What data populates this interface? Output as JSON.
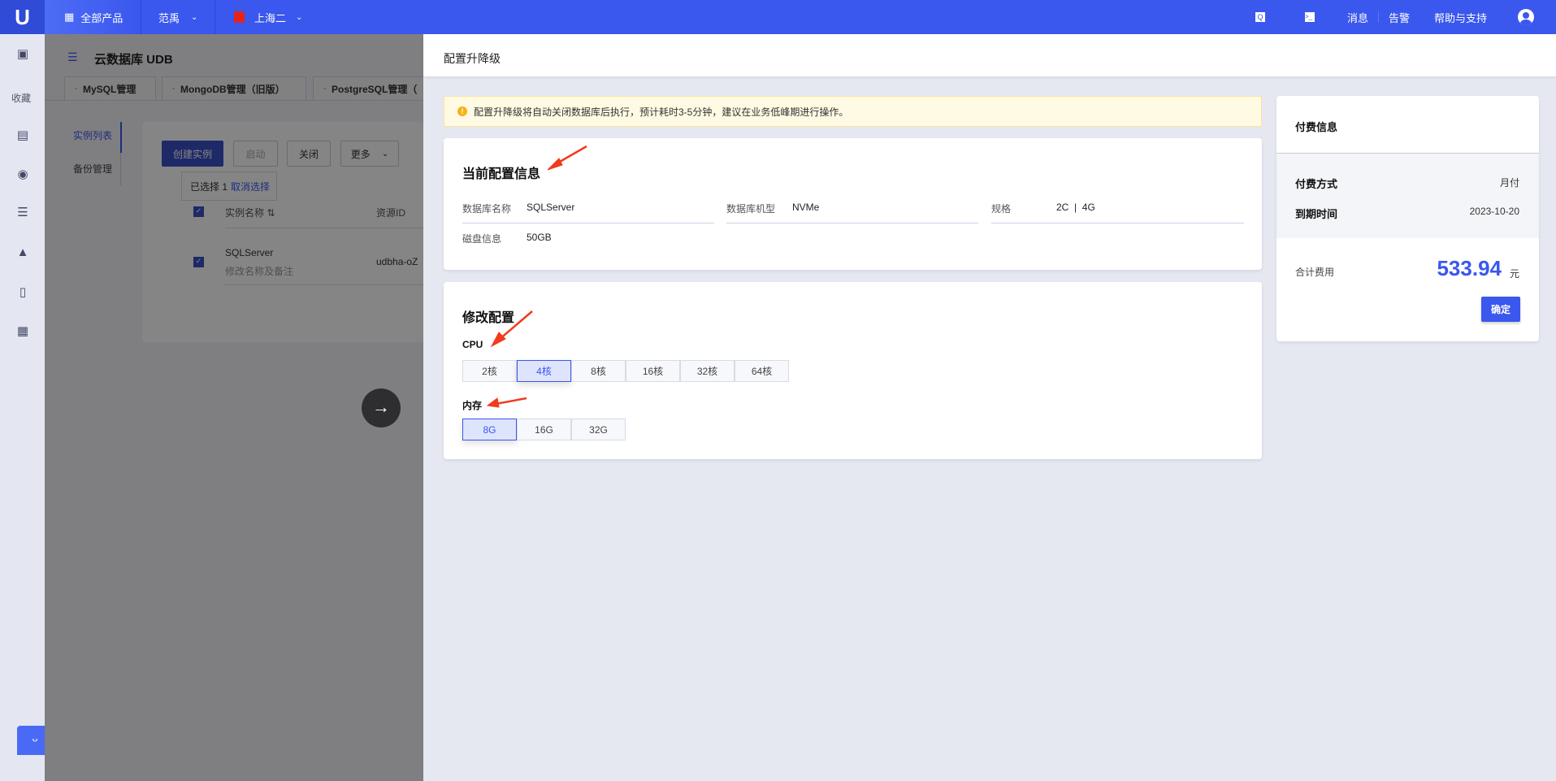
{
  "topbar": {
    "logo": "U",
    "all_products": "全部产品",
    "user": "范禹",
    "region": "上海二",
    "messages": "消息",
    "alerts": "告警",
    "help": "帮助与支持"
  },
  "sidebar": {
    "favorites": "收藏"
  },
  "page": {
    "title": "云数据库 UDB",
    "tabs": [
      "MySQL管理",
      "MongoDB管理（旧版）",
      "PostgreSQL管理（"
    ],
    "subnav": [
      "实例列表",
      "备份管理"
    ],
    "buttons": {
      "create": "创建实例",
      "start": "启动",
      "close": "关闭",
      "more": "更多"
    },
    "selection": {
      "text": "已选择 1",
      "cancel": "取消选择"
    },
    "table": {
      "headers": [
        "实例名称",
        "资源ID"
      ],
      "rows": [
        {
          "name": "SQLServer",
          "note": "修改名称及备注",
          "id": "udbha-oZ"
        }
      ]
    }
  },
  "drawer": {
    "title": "配置升降级",
    "warning": "配置升降级将自动关闭数据库后执行，预计耗时3-5分钟，建议在业务低峰期进行操作。",
    "current": {
      "title": "当前配置信息",
      "fields": [
        {
          "label": "数据库名称",
          "value": "SQLServer"
        },
        {
          "label": "数据库机型",
          "value": "NVMe"
        },
        {
          "label": "规格",
          "value": "2C  |  4G"
        },
        {
          "label": "磁盘信息",
          "value": "50GB"
        }
      ]
    },
    "modify": {
      "title": "修改配置",
      "cpu_label": "CPU",
      "cpu_options": [
        "2核",
        "4核",
        "8核",
        "16核",
        "32核",
        "64核"
      ],
      "cpu_selected": "4核",
      "mem_label": "内存",
      "mem_options": [
        "8G",
        "16G",
        "32G"
      ],
      "mem_selected": "8G"
    },
    "payment": {
      "title": "付费信息",
      "method_label": "付费方式",
      "method": "月付",
      "expiry_label": "到期时间",
      "expiry": "2023-10-20",
      "total_label": "合计费用",
      "total": "533.94",
      "unit": "元",
      "confirm": "确定"
    }
  },
  "colors": {
    "brand": "#3a57ee",
    "annotation_arrow": "#f23a1c",
    "warning_bg": "#fffae3"
  }
}
